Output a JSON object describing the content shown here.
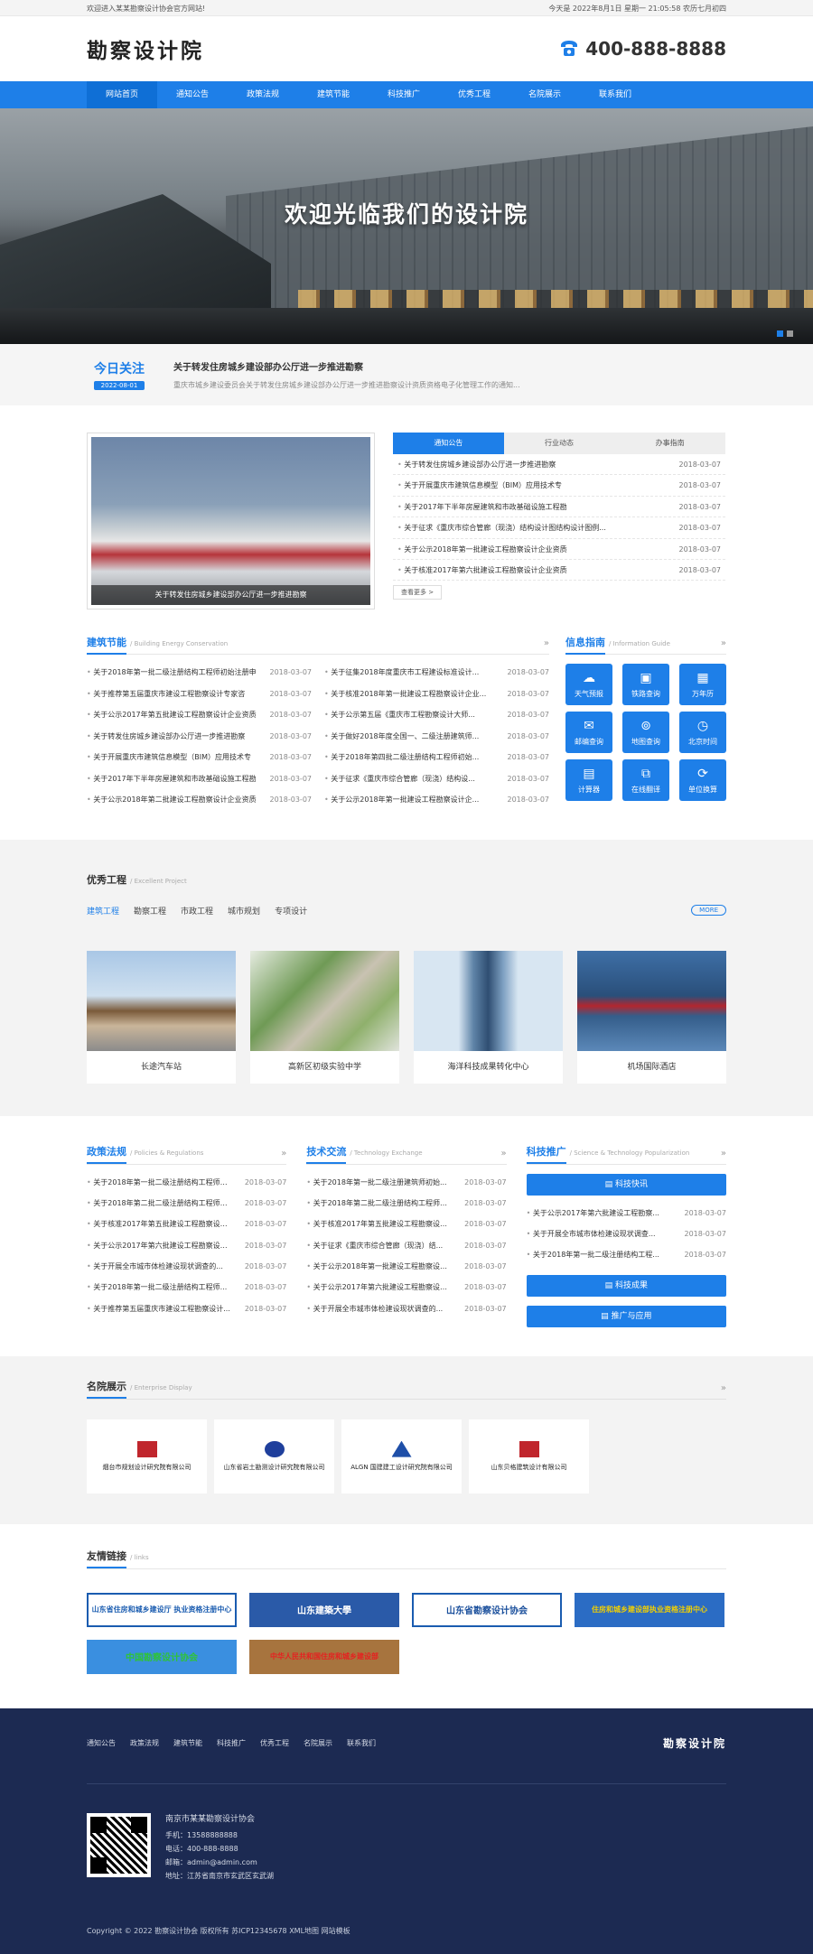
{
  "topbar": {
    "welcome": "欢迎进入某某勘察设计协会官方网站!",
    "date": "今天是 2022年8月1日 星期一 21:05:58 农历七月初四"
  },
  "header": {
    "logo": "勘察设计院",
    "phone": "400-888-8888"
  },
  "nav": [
    "网站首页",
    "通知公告",
    "政策法规",
    "建筑节能",
    "科技推广",
    "优秀工程",
    "名院展示",
    "联系我们"
  ],
  "banner": {
    "headline": "欢迎光临我们的设计院"
  },
  "today": {
    "label": "今日关注",
    "date": "2022-08-01",
    "title": "关于转发住房城乡建设部办公厅进一步推进勘察",
    "summary": "重庆市城乡建设委员会关于转发住房城乡建设部办公厅进一步推进勘察设计资质资格电子化管理工作的通知..."
  },
  "photo": {
    "caption": "关于转发住房城乡建设部办公厅进一步推进勘察"
  },
  "notice": {
    "tabs": [
      "通知公告",
      "行业动态",
      "办事指南"
    ],
    "items": [
      {
        "t": "关于转发住房城乡建设部办公厅进一步推进勘察",
        "d": "2018-03-07"
      },
      {
        "t": "关于开展重庆市建筑信息模型（BIM）应用技术专",
        "d": "2018-03-07"
      },
      {
        "t": "关于2017年下半年房屋建筑和市政基础设施工程勘",
        "d": "2018-03-07"
      },
      {
        "t": "关于征求《重庆市综合管廊（现浇）结构设计图结构设计图例...",
        "d": "2018-03-07"
      },
      {
        "t": "关于公示2018年第一批建设工程勘察设计企业资质",
        "d": "2018-03-07"
      },
      {
        "t": "关于核准2017年第六批建设工程勘察设计企业资质",
        "d": "2018-03-07"
      }
    ],
    "more": "查看更多 >"
  },
  "energy": {
    "title": "建筑节能",
    "sub": "/ Building Energy Conservation",
    "left": [
      {
        "t": "关于2018年第一批二级注册结构工程师初始注册申",
        "d": "2018-03-07"
      },
      {
        "t": "关于推荐第五届重庆市建设工程勘察设计专家咨",
        "d": "2018-03-07"
      },
      {
        "t": "关于公示2017年第五批建设工程勘察设计企业资质",
        "d": "2018-03-07"
      },
      {
        "t": "关于转发住房城乡建设部办公厅进一步推进勘察",
        "d": "2018-03-07"
      },
      {
        "t": "关于开展重庆市建筑信息模型（BIM）应用技术专",
        "d": "2018-03-07"
      },
      {
        "t": "关于2017年下半年房屋建筑和市政基础设施工程勘",
        "d": "2018-03-07"
      },
      {
        "t": "关于公示2018年第二批建设工程勘察设计企业资质",
        "d": "2018-03-07"
      }
    ],
    "right": [
      {
        "t": "关于征集2018年度重庆市工程建设标准设计...",
        "d": "2018-03-07"
      },
      {
        "t": "关于核准2018年第一批建设工程勘察设计企业...",
        "d": "2018-03-07"
      },
      {
        "t": "关于公示第五届《重庆市工程勘察设计大师...",
        "d": "2018-03-07"
      },
      {
        "t": "关于做好2018年度全国一、二级注册建筑师...",
        "d": "2018-03-07"
      },
      {
        "t": "关于2018年第四批二级注册结构工程师初始...",
        "d": "2018-03-07"
      },
      {
        "t": "关于征求《重庆市综合管廊（现浇）结构设...",
        "d": "2018-03-07"
      },
      {
        "t": "关于公示2018年第一批建设工程勘察设计企...",
        "d": "2018-03-07"
      }
    ]
  },
  "info": {
    "title": "信息指南",
    "sub": "/ Information Guide",
    "items": [
      {
        "i": "☁",
        "l": "天气预报"
      },
      {
        "i": "▣",
        "l": "铁路查询"
      },
      {
        "i": "▦",
        "l": "万年历"
      },
      {
        "i": "✉",
        "l": "邮编查询"
      },
      {
        "i": "⊚",
        "l": "地图查询"
      },
      {
        "i": "◷",
        "l": "北京时间"
      },
      {
        "i": "▤",
        "l": "计算器"
      },
      {
        "i": "⧉",
        "l": "在线翻译"
      },
      {
        "i": "⟳",
        "l": "单位换算"
      }
    ]
  },
  "projects": {
    "title": "优秀工程",
    "sub": "/ Excellent Project",
    "tabs": [
      "建筑工程",
      "勘察工程",
      "市政工程",
      "城市规划",
      "专项设计"
    ],
    "more": "MORE",
    "cards": [
      "长途汽车站",
      "高新区初级实验中学",
      "海洋科技成果转化中心",
      "机场国际酒店"
    ]
  },
  "policy": {
    "title": "政策法规",
    "sub": "/ Policies & Regulations",
    "items": [
      {
        "t": "关于2018年第一批二级注册结构工程师初始...",
        "d": "2018-03-07"
      },
      {
        "t": "关于2018年第二批二级注册结构工程师初始...",
        "d": "2018-03-07"
      },
      {
        "t": "关于核准2017年第五批建设工程勘察设计...",
        "d": "2018-03-07"
      },
      {
        "t": "关于公示2017年第六批建设工程勘察设计...",
        "d": "2018-03-07"
      },
      {
        "t": "关于开展全市城市体检建设现状调查的...",
        "d": "2018-03-07"
      },
      {
        "t": "关于2018年第一批二级注册结构工程师...",
        "d": "2018-03-07"
      },
      {
        "t": "关于推荐第五届重庆市建设工程勘察设计...",
        "d": "2018-03-07"
      }
    ]
  },
  "tech": {
    "title": "技术交流",
    "sub": "/ Technology Exchange",
    "items": [
      {
        "t": "关于2018年第一批二级注册建筑师初始...",
        "d": "2018-03-07"
      },
      {
        "t": "关于2018年第二批二级注册结构工程师初始...",
        "d": "2018-03-07"
      },
      {
        "t": "关于核准2017年第五批建设工程勘察设计...",
        "d": "2018-03-07"
      },
      {
        "t": "关于征求《重庆市综合管廊（现浇）结...",
        "d": "2018-03-07"
      },
      {
        "t": "关于公示2018年第一批建设工程勘察设计...",
        "d": "2018-03-07"
      },
      {
        "t": "关于公示2017年第六批建设工程勘察设计...",
        "d": "2018-03-07"
      },
      {
        "t": "关于开展全市城市体检建设现状调查的...",
        "d": "2018-03-07"
      }
    ]
  },
  "science": {
    "title": "科技推广",
    "sub": "/ Science & Technology Popularization",
    "btn1": "科技快讯",
    "btn2": "科技成果",
    "btn3": "推广与应用",
    "items": [
      {
        "t": "关于公示2017年第六批建设工程勘察...",
        "d": "2018-03-07"
      },
      {
        "t": "关于开展全市城市体检建设现状调查...",
        "d": "2018-03-07"
      },
      {
        "t": "关于2018年第一批二级注册结构工程...",
        "d": "2018-03-07"
      }
    ]
  },
  "enterprise": {
    "title": "名院展示",
    "sub": "/ Enterprise Display",
    "logos": [
      "烟台市规划设计研究院有限公司",
      "山东省岩土勘测设计研究院有限公司",
      "ALGN 国建建工设计研究院有限公司",
      "山东贝格建筑设计有限公司"
    ]
  },
  "friendly": {
    "title": "友情链接",
    "sub": "/ links",
    "items": [
      "山东省住房和城乡建设厅 执业资格注册中心",
      "山东建築大學",
      "山东省勘察设计协会",
      "住房和城乡建设部执业资格注册中心",
      "中国勘察设计协会",
      "中华人民共和国住房和城乡建设部"
    ]
  },
  "footer": {
    "nav": [
      "通知公告",
      "政策法规",
      "建筑节能",
      "科技推广",
      "优秀工程",
      "名院展示",
      "联系我们"
    ],
    "logo": "勘察设计院",
    "org": "南京市某某勘察设计协会",
    "phone": "手机：13588888888",
    "tel": "电话：400-888-8888",
    "email": "邮箱：admin@admin.com",
    "addr": "地址：江苏省南京市玄武区玄武湖",
    "copy": "Copyright © 2022 勘察设计协会 版权所有 苏ICP12345678 XML地图 网站模板"
  }
}
